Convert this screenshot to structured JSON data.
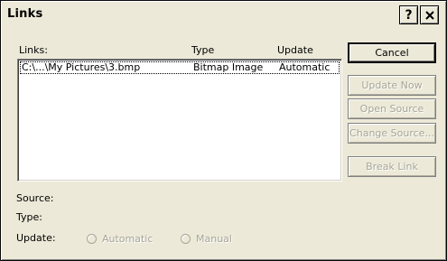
{
  "window": {
    "title": "Links",
    "help_button": "?",
    "close_button_icon": "close-icon"
  },
  "list": {
    "headers": {
      "links": "Links:",
      "type": "Type",
      "update": "Update"
    },
    "rows": [
      {
        "link": "C:\\...\\My Pictures\\3.bmp",
        "type": "Bitmap Image",
        "update": "Automatic"
      }
    ]
  },
  "buttons": {
    "cancel": "Cancel",
    "update_now": "Update Now",
    "open_source": "Open Source",
    "change_source": "Change Source...",
    "break_link": "Break Link"
  },
  "details": {
    "source_label": "Source:",
    "type_label": "Type:",
    "update_label": "Update:",
    "automatic_option": "Automatic",
    "manual_option": "Manual"
  },
  "colors": {
    "dialog_bg": "#ece9d8",
    "disabled_text": "#a7a596"
  }
}
